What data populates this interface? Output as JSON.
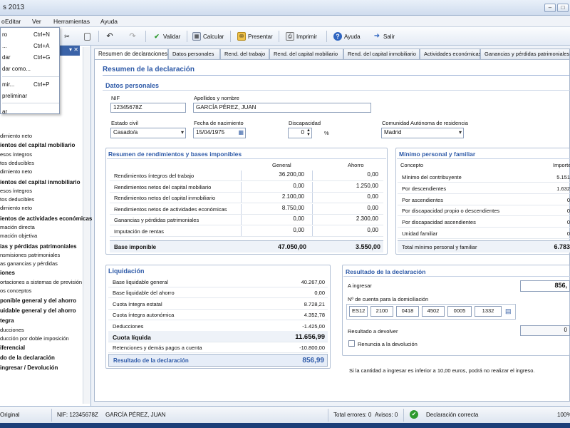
{
  "window": {
    "title": "s 2013"
  },
  "menu": [
    "o",
    "Editar",
    "Ver",
    "Herramientas",
    "Ayuda"
  ],
  "dropdown": {
    "items": [
      {
        "label": "ro",
        "shortcut": "Ctrl+N"
      },
      {
        "label": "...",
        "shortcut": "Ctrl+A"
      },
      {
        "label": "dar",
        "shortcut": "Ctrl+G"
      },
      {
        "label": "dar como...",
        "shortcut": ""
      },
      {
        "label": "mir...",
        "shortcut": "Ctrl+P"
      },
      {
        "label": "preliminar",
        "shortcut": ""
      },
      {
        "label": "ar",
        "shortcut": ""
      }
    ]
  },
  "toolbar": {
    "validar": "Validar",
    "calcular": "Calcular",
    "presentar": "Presentar",
    "imprimir": "Imprimir",
    "ayuda": "Ayuda",
    "salir": "Salir"
  },
  "sidebar": {
    "items": [
      {
        "text": "dimiento neto",
        "bold": false
      },
      {
        "text": "ientos del capital mobiliario",
        "bold": true
      },
      {
        "text": "esos íntegros",
        "bold": false
      },
      {
        "text": "tos deducibles",
        "bold": false
      },
      {
        "text": "dimiento neto",
        "bold": false
      },
      {
        "text": "ientos del capital inmobiliario",
        "bold": true
      },
      {
        "text": "esos íntegros",
        "bold": false
      },
      {
        "text": "tos deducibles",
        "bold": false
      },
      {
        "text": "dimiento neto",
        "bold": false
      },
      {
        "text": "ientos de actividades económicas",
        "bold": true
      },
      {
        "text": "mación directa",
        "bold": false
      },
      {
        "text": "mación objetiva",
        "bold": false
      },
      {
        "text": "ias y pérdidas patrimoniales",
        "bold": true
      },
      {
        "text": "nsmisiones patrimoniales",
        "bold": false
      },
      {
        "text": "as ganancias y pérdidas",
        "bold": false
      },
      {
        "text": "iones",
        "bold": true
      },
      {
        "text": "ortaciones a sistemas de previsión",
        "bold": false
      },
      {
        "text": "os conceptos",
        "bold": false
      },
      {
        "text": "ponible general y del ahorro",
        "bold": true
      },
      {
        "text": "uidable general y del ahorro",
        "bold": true
      },
      {
        "text": "tegra",
        "bold": true
      },
      {
        "text": "ducciones",
        "bold": false
      },
      {
        "text": "ducción por doble imposición",
        "bold": false
      },
      {
        "text": "iferencial",
        "bold": true
      },
      {
        "text": "do de la declaración",
        "bold": true
      },
      {
        "text": "ingresar / Devolución",
        "bold": true
      }
    ]
  },
  "tabs": [
    {
      "label": "Resumen de declaraciones",
      "active": true
    },
    {
      "label": "Datos personales",
      "active": false
    },
    {
      "label": "Rend. del trabajo",
      "active": false
    },
    {
      "label": "Rend. del capital mobiliario",
      "active": false
    },
    {
      "label": "Rend. del capital inmobiliario",
      "active": false
    },
    {
      "label": "Actividades económicas",
      "active": false
    },
    {
      "label": "Ganancias y pérdidas patrimoniales",
      "active": false
    }
  ],
  "main": {
    "heading": "Resumen de la declaración"
  },
  "personal": {
    "title": "Datos personales",
    "nif_label": "NIF",
    "nif": "12345678Z",
    "name_label": "Apellidos y nombre",
    "name": "GARCÍA PÉREZ, JUAN",
    "civil_label": "Estado civil",
    "civil": "Casado/a",
    "birth_label": "Fecha de nacimiento",
    "birth": "15/04/1975",
    "disc_label": "Discapacidad",
    "disc": "0",
    "disc_unit": "%",
    "ccaa_label": "Comunidad Autónoma de residencia",
    "ccaa": "Madrid"
  },
  "rendimientos": {
    "title": "Resumen de rendimientos y bases imponibles",
    "col_general": "General",
    "col_ahorro": "Ahorro",
    "rows": [
      {
        "label": "Rendimientos íntegros del trabajo",
        "general": "36.200,00",
        "ahorro": "0,00"
      },
      {
        "label": "Rendimientos netos del capital mobiliario",
        "general": "0,00",
        "ahorro": "1.250,00"
      },
      {
        "label": "Rendimientos netos del capital inmobiliario",
        "general": "2.100,00",
        "ahorro": "0,00"
      },
      {
        "label": "Rendimientos netos de actividades económicas",
        "general": "8.750,00",
        "ahorro": "0,00"
      },
      {
        "label": "Ganancias y pérdidas patrimoniales",
        "general": "0,00",
        "ahorro": "2.300,00"
      },
      {
        "label": "Imputación de rentas",
        "general": "0,00",
        "ahorro": "0,00"
      }
    ],
    "total_label": "Base imponible",
    "total_general": "47.050,00",
    "total_ahorro": "3.550,00"
  },
  "minimo": {
    "title": "Mínimo personal y familiar",
    "col_concepto": "Concepto",
    "col_importe": "Importe",
    "rows": [
      {
        "label": "Mínimo del contribuyente",
        "value": "5.151"
      },
      {
        "label": "Por descendientes",
        "value": "1.632"
      },
      {
        "label": "Por ascendientes",
        "value": "0"
      },
      {
        "label": "Por discapacidad propio o descendientes",
        "value": "0"
      },
      {
        "label": "Por discapacidad ascendientes",
        "value": "0"
      },
      {
        "label": "Unidad familiar",
        "value": "0"
      }
    ],
    "total_label": "Total mínimo personal y familiar",
    "total": "6.783"
  },
  "liquidacion": {
    "title": "Liquidación",
    "rows": [
      {
        "label": "Base liquidable general",
        "value": "40.267,00",
        "bold": false
      },
      {
        "label": "Base liquidable del ahorro",
        "value": "0,00",
        "bold": false
      },
      {
        "label": "Cuota íntegra estatal",
        "value": "8.728,21",
        "bold": false
      },
      {
        "label": "Cuota íntegra autonómica",
        "value": "4.352,78",
        "bold": false
      },
      {
        "label": "Deducciones",
        "value": "-1.425,00",
        "bold": false
      },
      {
        "label": "Cuota líquida",
        "value": "11.656,99",
        "bold": true
      },
      {
        "label": "Retenciones y demás pagos a cuenta",
        "value": "-10.800,00",
        "bold": false
      }
    ],
    "result_label": "Resultado de la declaración",
    "result_value": "856,99"
  },
  "resultado": {
    "title": "Resultado de la declaración",
    "ingresar_label": "A ingresar",
    "ingresar": "856,",
    "cuenta_label": "Nº de cuenta para la domiciliación",
    "cuenta": [
      "ES12",
      "2100",
      "0418",
      "4502",
      "0005",
      "1332"
    ],
    "devolver_label": "Resultado a devolver",
    "devolver": "0",
    "renuncia_label": "Renuncia a la devolución",
    "note": "Si la cantidad a ingresar es inferior a 10,00 euros, podrá no realizar el ingreso."
  },
  "status": {
    "mode": "Original",
    "nif": "NIF: 12345678Z",
    "name": "GARCÍA PÉREZ, JUAN",
    "errors": "Total errores: 0",
    "warnings": "Avisos: 0",
    "state": "Declaración correcta",
    "zoom": "100%"
  },
  "colors": {
    "accent": "#2e5aa8",
    "ok": "#2e9a2e",
    "sidebar_head": "#3a63a8"
  }
}
